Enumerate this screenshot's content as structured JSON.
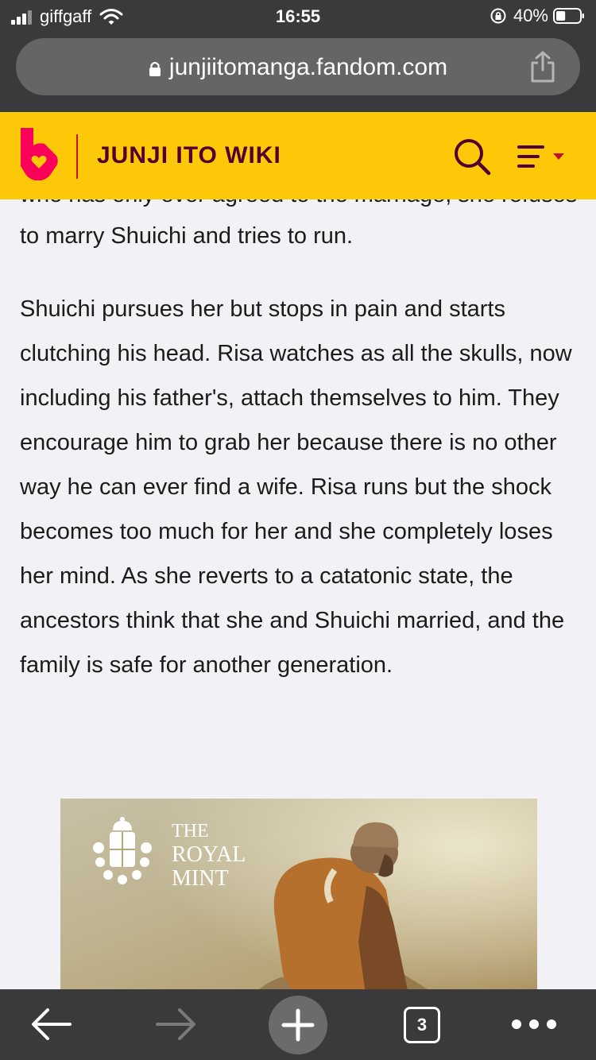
{
  "status_bar": {
    "carrier": "giffgaff",
    "time": "16:55",
    "battery_percent": "40%",
    "battery_level": 0.4
  },
  "browser": {
    "url": "junjiitomanga.fandom.com",
    "icons": [
      "lock-icon",
      "share-icon"
    ]
  },
  "wiki_header": {
    "title": "JUNJI ITO WIKI",
    "colors": {
      "background": "#fdc807",
      "title": "#520032",
      "logo": "#fa005a"
    },
    "icons": [
      "fandom-logo",
      "search-icon",
      "menu-icon"
    ]
  },
  "article": {
    "cut_line": "who has only ever agreed to the marriage, she refuses",
    "paragraph_1": "to marry Shuichi and tries to run.",
    "paragraph_2": "Shuichi pursues her but stops in pain and starts clutching his head. Risa watches as all the skulls, now including his father's, attach themselves to him.  They encourage him to grab her because there is no other way he can ever find a wife. Risa runs but the shock becomes too much for her and she completely loses her mind. As she reverts to a catatonic state, the ancestors think that she and Shuichi married, and the family is safe for another generation."
  },
  "ad": {
    "brand_line_1": "THE",
    "brand_line_2": "ROYAL",
    "brand_line_3": "MINT"
  },
  "toolbar": {
    "tab_count": "3",
    "icons": [
      "back-icon",
      "forward-icon",
      "new-tab-icon",
      "tabs-icon",
      "more-icon"
    ]
  }
}
